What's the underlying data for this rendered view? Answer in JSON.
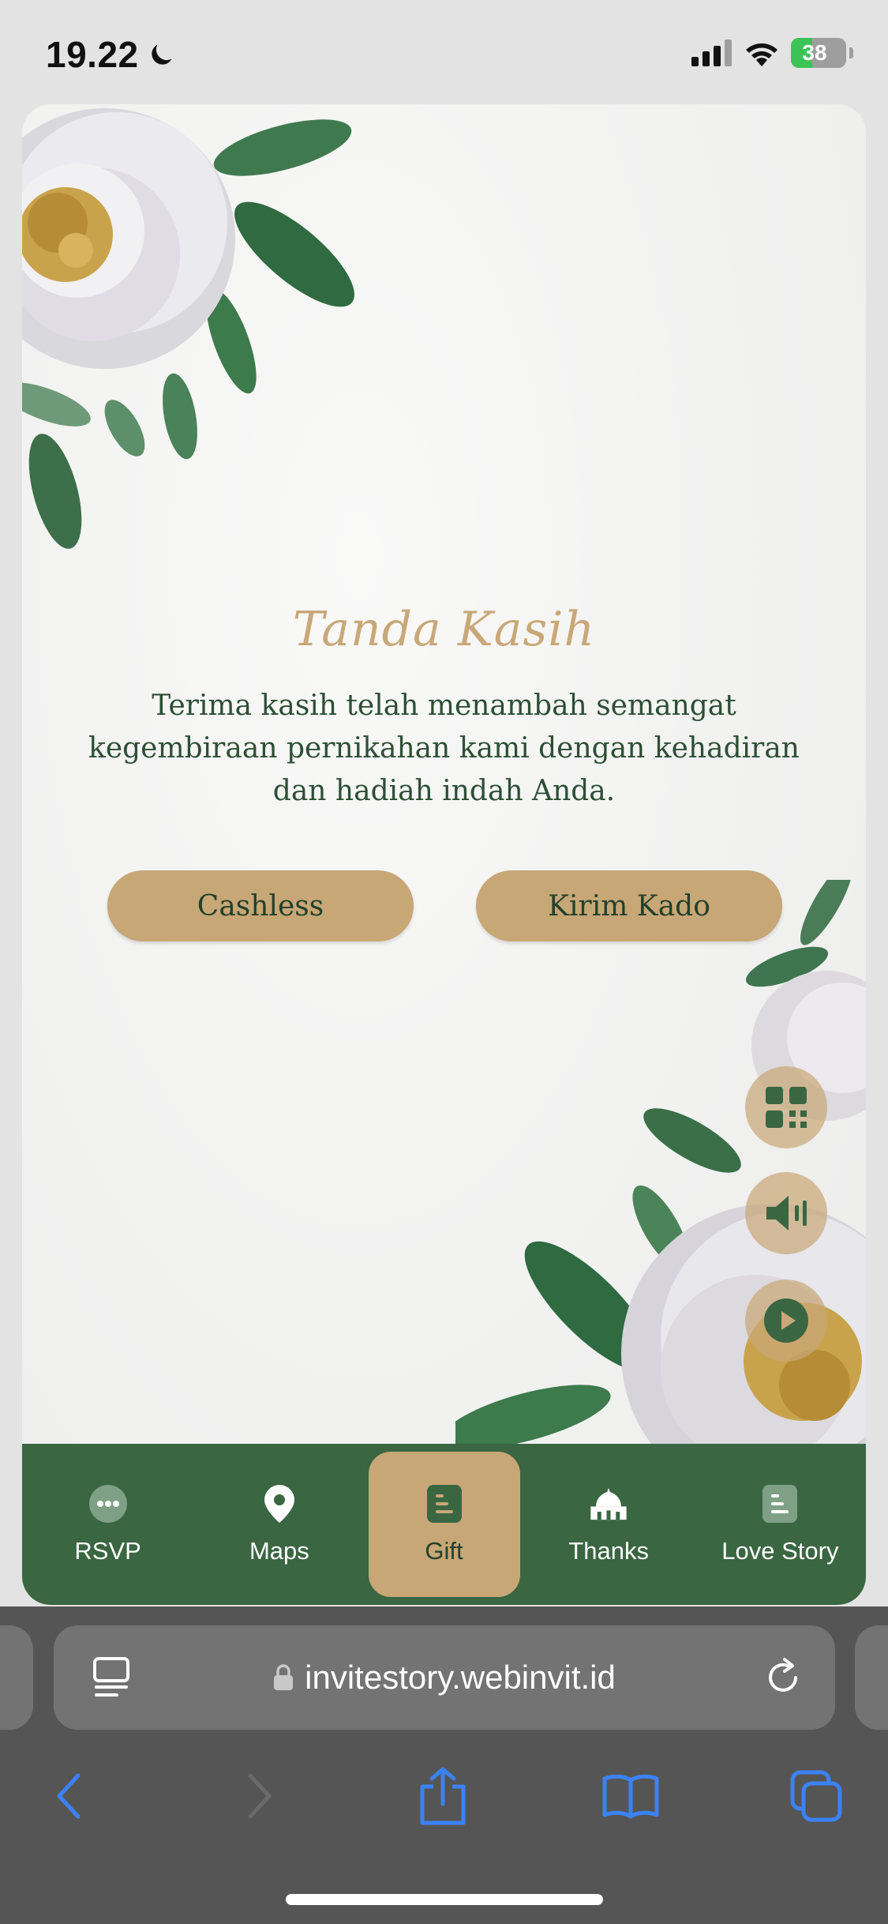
{
  "status_bar": {
    "time": "19.22",
    "battery_level": "38",
    "battery_fraction": 0.38
  },
  "card": {
    "title": "Tanda Kasih",
    "message": "Terima kasih telah menambah semangat kegembiraan pernikahan kami dengan kehadiran dan hadiah indah Anda.",
    "buttons": {
      "cashless": "Cashless",
      "kirim_kado": "Kirim Kado"
    },
    "colors": {
      "accent": "#c7a776",
      "primary_green": "#3a6642",
      "text_green": "#2d4f35"
    }
  },
  "floating_buttons": [
    {
      "icon": "qr-code-icon"
    },
    {
      "icon": "speaker-icon"
    },
    {
      "icon": "play-icon"
    }
  ],
  "bottom_nav": {
    "items": [
      {
        "label": "RSVP",
        "icon": "chat-bubble-icon"
      },
      {
        "label": "Maps",
        "icon": "map-pin-icon"
      },
      {
        "label": "Gift",
        "icon": "gift-document-icon",
        "active": true
      },
      {
        "label": "Thanks",
        "icon": "mosque-icon"
      },
      {
        "label": "Love Story",
        "icon": "document-icon"
      }
    ]
  },
  "browser": {
    "url": "invitestory.webinvit.id"
  }
}
